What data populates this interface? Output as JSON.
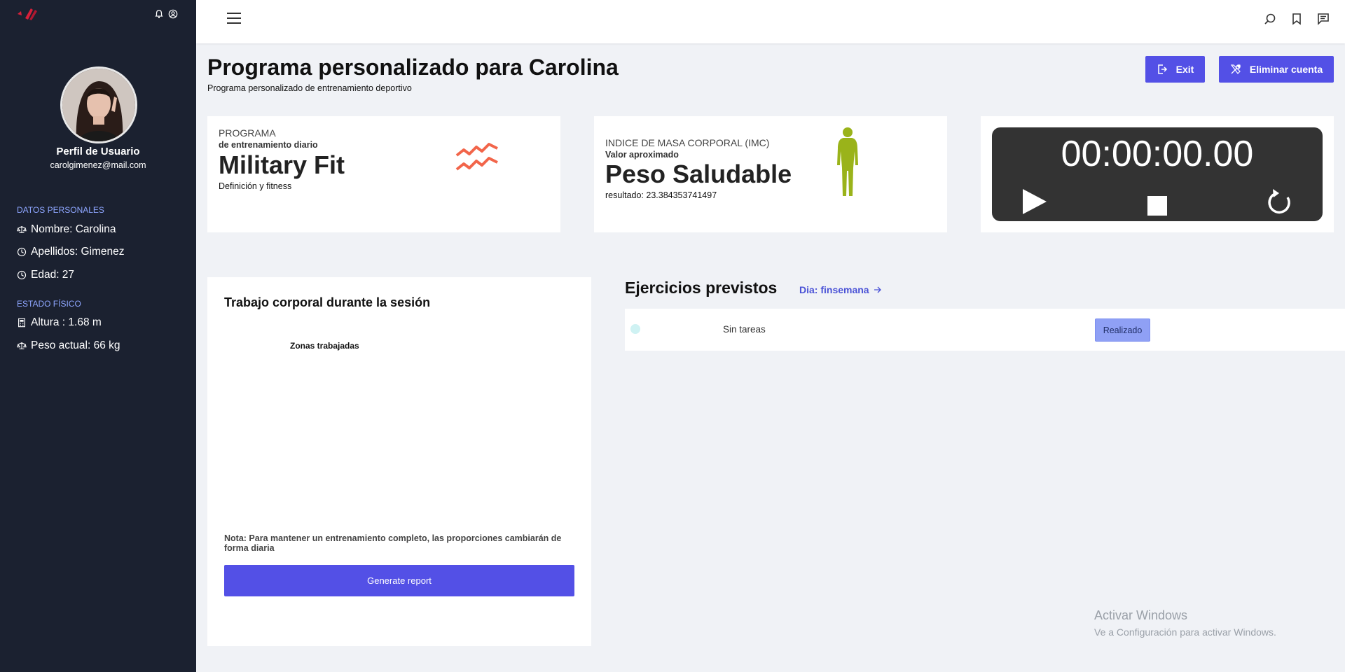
{
  "sidebar": {
    "profile_title": "Perfil de Usuario",
    "email": "carolgimenez@mail.com",
    "personal_section": "DATOS PERSONALES",
    "personal": [
      {
        "text": "Nombre: Carolina",
        "icon": "scale-icon"
      },
      {
        "text": "Apellidos: Gimenez",
        "icon": "clock-icon"
      },
      {
        "text": "Edad: 27",
        "icon": "clock-icon"
      }
    ],
    "physical_section": "ESTADO FÍSICO",
    "physical": [
      {
        "text": "Altura : 1.68 m",
        "icon": "calculator-icon"
      },
      {
        "text": "Peso actual: 66 kg",
        "icon": "scale-icon"
      }
    ]
  },
  "header": {
    "title": "Programa personalizado para Carolina",
    "subtitle": "Programa personalizado de entrenamiento deportivo",
    "exit_label": "Exit",
    "delete_label": "Eliminar cuenta"
  },
  "program_card": {
    "label": "PROGRAMA",
    "sub": "de entrenamiento diario",
    "name": "Military Fit",
    "desc": "Definición y fitness",
    "icon": "zigzag-icon",
    "icon_color": "#f2654a"
  },
  "bmi_card": {
    "label": "INDICE DE MASA CORPORAL (IMC)",
    "sub": "Valor aproximado",
    "status": "Peso Saludable",
    "result": "resultado: 23.384353741497",
    "icon": "body-silhouette-icon",
    "icon_color": "#9ab31a"
  },
  "timer": {
    "display": "00:00:00.00",
    "controls": [
      "play-icon",
      "stop-icon",
      "reset-icon"
    ]
  },
  "body_panel": {
    "title": "Trabajo corporal durante la sesión",
    "zones_title": "Zonas trabajadas",
    "note": "Nota: Para mantener un entrenamiento completo, las proporciones cambiarán de forma diaria",
    "report_button": "Generate report"
  },
  "exercises": {
    "title": "Ejercicios previstos",
    "day_link": "Dia: finsemana",
    "tasks": [
      {
        "text": "Sin tareas",
        "button": "Realizado"
      }
    ]
  },
  "watermark": {
    "line1": "Activar Windows",
    "line2": "Ve a Configuración para activar Windows."
  },
  "colors": {
    "accent": "#5350e6",
    "sidebar_bg": "#1b2130",
    "section_title": "#8ea6ff"
  }
}
